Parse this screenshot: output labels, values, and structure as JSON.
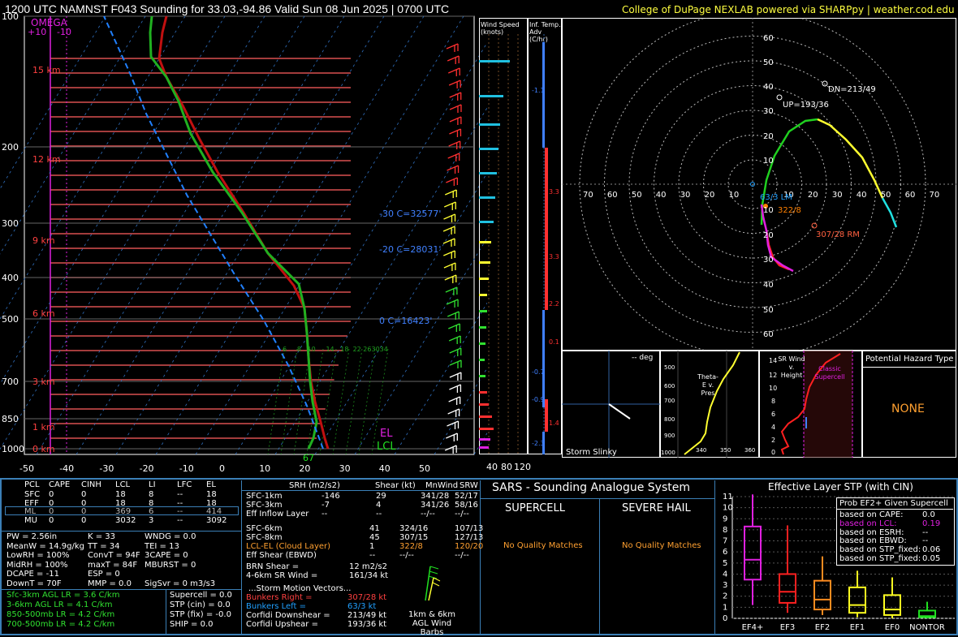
{
  "header": {
    "title": "1200 UTC NAMNST F043 Sounding for 33.03,-94.86 Valid  Sun 08 Jun 2025 | 0700 UTC",
    "credit": "College of DuPage NEXLAB powered via SHARPpy | weather.cod.edu"
  },
  "skewt": {
    "omega_label": "OMEGA",
    "omega_ticks": [
      "+10",
      "-10"
    ],
    "pressure_ticks": [
      "100",
      "200",
      "300",
      "400",
      "500",
      "700",
      "850",
      "1000"
    ],
    "temp_ticks": [
      "-50",
      "-40",
      "-30",
      "-20",
      "-10",
      "0",
      "10",
      "20",
      "30",
      "40",
      "50"
    ],
    "height_labels": [
      "15 km",
      "12 km",
      "9 km",
      "6 km",
      "3 km",
      "1 km",
      "0 km"
    ],
    "freezing_labels": [
      "-30 C=32577'",
      "-20 C=28031'",
      "0 C=16423'"
    ],
    "el_label": "EL",
    "lcl_label": "LCL",
    "sfc_temp": "67",
    "mixing_ratio_labels": [
      "6",
      "8",
      "10",
      "14",
      "18",
      "22",
      "26",
      "30",
      "34"
    ]
  },
  "panels": {
    "wind_speed_title": "Wind Speed (knots)",
    "wind_speed_ticks": [
      "40",
      "80",
      "120"
    ],
    "inf_temp_title": "Inf. Temp. Adv (C/hr)",
    "inf_temp_values": [
      "-1.1",
      "3.3",
      "3.3",
      "2.2",
      "0.1",
      "-0.7",
      "-0.9",
      "1.4",
      "-2.3"
    ]
  },
  "hodograph": {
    "rings": [
      "10",
      "20",
      "30",
      "40",
      "50",
      "60"
    ],
    "x_ticks": [
      "70",
      "60",
      "50",
      "40",
      "30",
      "20",
      "10",
      "10",
      "20",
      "30",
      "40",
      "50",
      "60",
      "70"
    ],
    "labels": {
      "dn": "DN=213/49",
      "up": "UP=193/36",
      "lm": "63/3 LM",
      "mean": "322/8",
      "rm": "307/28 RM"
    }
  },
  "small_panels": {
    "storm_slinky": "Storm Slinky",
    "deg": "-- deg",
    "theta_title": "Theta-E v. Pres",
    "theta_p_ticks": [
      "500",
      "600",
      "700",
      "800",
      "900",
      "1000"
    ],
    "theta_x_ticks": [
      "340",
      "350",
      "360"
    ],
    "srwind_title": "SR Wind v. Height",
    "srwind_h_ticks": [
      "14",
      "12",
      "10",
      "8",
      "6",
      "4",
      "2",
      "0"
    ],
    "srwind_label": "Classic Supercell",
    "hazard_title": "Potential Hazard Type",
    "hazard_value": "NONE"
  },
  "parcel_table": {
    "headers": [
      "PCL",
      "CAPE",
      "CINH",
      "LCL",
      "LI",
      "LFC",
      "EL"
    ],
    "rows": [
      [
        "SFC",
        "0",
        "0",
        "18",
        "8",
        "--",
        "18"
      ],
      [
        "EFF",
        "0",
        "0",
        "18",
        "8",
        "--",
        "18"
      ],
      [
        "ML",
        "0",
        "0",
        "369",
        "6",
        "--",
        "414"
      ],
      [
        "MU",
        "0",
        "0",
        "3032",
        "3",
        "--",
        "3092"
      ]
    ]
  },
  "indices": [
    [
      "PW = 2.56in",
      "K = 33",
      "WNDG = 0.0"
    ],
    [
      "MeanW = 14.9g/kg",
      "TT = 34",
      "TEI = 13"
    ],
    [
      "LowRH = 100%",
      "ConvT = 94F",
      "3CAPE = 0"
    ],
    [
      "MidRH = 100%",
      "maxT = 84F",
      "MBURST = 0"
    ],
    [
      "DCAPE = -11",
      "ESP = 0",
      ""
    ],
    [
      "DownT = 70F",
      "MMP = 0.0",
      "SigSvr = 0 m3/s3"
    ]
  ],
  "lapse_rates": [
    "Sfc-3km AGL LR = 3.6 C/km",
    "3-6km AGL LR = 4.1 C/km",
    "850-500mb LR = 4.2 C/km",
    "700-500mb LR = 4.2 C/km"
  ],
  "composite": [
    "Supercell = 0.0",
    "STP (cin) = 0.0",
    "STP (fix) = -0.0",
    "SHIP = 0.0"
  ],
  "kinematics": {
    "headers": [
      "SRH (m2/s2)",
      "Shear (kt)",
      "MnWind",
      "SRW"
    ],
    "rows": [
      [
        "SFC-1km",
        "-146",
        "29",
        "341/28",
        "52/17"
      ],
      [
        "SFC-3km",
        "-7",
        "4",
        "341/26",
        "58/16"
      ],
      [
        "Eff Inflow Layer",
        "--",
        "--",
        "--/--",
        "--/--"
      ],
      [
        "",
        "",
        "",
        "",
        ""
      ],
      [
        "SFC-6km",
        "41",
        "324/16",
        "107/13",
        ""
      ],
      [
        "SFC-8km",
        "45",
        "307/15",
        "127/13",
        ""
      ],
      [
        "LCL-EL (Cloud Layer)",
        "1",
        "322/8",
        "120/20",
        ""
      ],
      [
        "Eff Shear (EBWD)",
        "--",
        "--/--",
        "--/--",
        ""
      ]
    ],
    "brn": [
      "BRN Shear =",
      "12 m2/s2"
    ],
    "srwind46": [
      "4-6km SR Wind =",
      "161/34 kt"
    ],
    "storm_title": "...Storm Motion Vectors...",
    "storm": [
      [
        "Bunkers Right =",
        "307/28 kt"
      ],
      [
        "Bunkers Left =",
        "63/3 kt"
      ],
      [
        "Corfidi Downshear =",
        "213/49 kt"
      ],
      [
        "Corfidi Upshear =",
        "193/36 kt"
      ]
    ],
    "barb_label": "1km & 6km AGL Wind Barbs"
  },
  "sars": {
    "title": "SARS - Sounding Analogue System",
    "supercell": "SUPERCELL",
    "hail": "SEVERE HAIL",
    "supercell_val": "No Quality Matches",
    "hail_val": "No Quality Matches"
  },
  "stp": {
    "title": "Effective Layer STP (with CIN)",
    "box_title": "Prob EF2+ Given Supercell",
    "probs": [
      [
        "based on CAPE:",
        "0.0"
      ],
      [
        "based on LCL:",
        "0.19"
      ],
      [
        "based on ESRH:",
        "--"
      ],
      [
        "based on EBWD:",
        "--"
      ],
      [
        "based on STP_fixed:",
        "0.06"
      ],
      [
        "based on STP_fixed:",
        "0.05"
      ]
    ],
    "colors": {
      "ef4": "#e020e0",
      "ef3": "#ff2020",
      "ef2": "#ff8c20",
      "ef1": "#ffff20",
      "ef0": "#ffff20",
      "nontor": "#20e020"
    }
  },
  "chart_data": {
    "type": "box",
    "title": "Effective Layer STP (with CIN)",
    "categories": [
      "EF4+",
      "EF3",
      "EF2",
      "EF1",
      "EF0",
      "NONTOR"
    ],
    "ylim": [
      0,
      11
    ],
    "series": [
      {
        "name": "EF4+",
        "whisker_low": 1.2,
        "q1": 3.5,
        "median": 5.3,
        "q3": 8.3,
        "whisker_high": 11.2
      },
      {
        "name": "EF3",
        "whisker_low": 0.5,
        "q1": 1.4,
        "median": 2.4,
        "q3": 4.0,
        "whisker_high": 8.4
      },
      {
        "name": "EF2",
        "whisker_low": 0.3,
        "q1": 0.8,
        "median": 1.7,
        "q3": 3.4,
        "whisker_high": 5.6
      },
      {
        "name": "EF1",
        "whisker_low": 0.1,
        "q1": 0.5,
        "median": 1.2,
        "q3": 2.8,
        "whisker_high": 4.3
      },
      {
        "name": "EF0",
        "whisker_low": 0.0,
        "q1": 0.3,
        "median": 0.8,
        "q3": 2.1,
        "whisker_high": 3.7
      },
      {
        "name": "NONTOR",
        "whisker_low": 0.0,
        "q1": 0.1,
        "median": 0.2,
        "q3": 0.7,
        "whisker_high": 1.5
      }
    ]
  }
}
